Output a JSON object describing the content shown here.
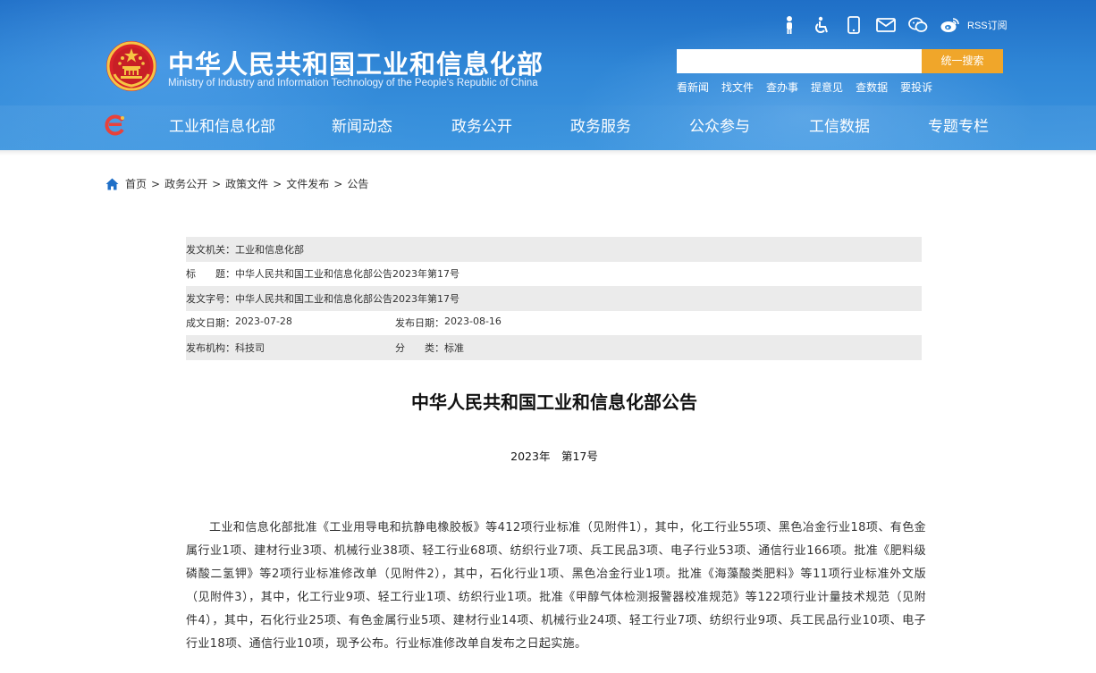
{
  "header": {
    "site_title": "中华人民共和国工业和信息化部",
    "site_subtitle": "Ministry of Industry and Information Technology of the People's Republic of China",
    "top_icons": [
      "elderly-mode-icon",
      "accessibility-icon",
      "mobile-icon",
      "mail-icon",
      "wechat-icon",
      "weibo-icon"
    ],
    "rss_label": "RSS订阅",
    "search": {
      "placeholder": "",
      "button_label": "统一搜索"
    },
    "quick_links": [
      "看新闻",
      "找文件",
      "查办事",
      "提意见",
      "查数据",
      "要投诉"
    ],
    "nav": [
      "工业和信息化部",
      "新闻动态",
      "政务公开",
      "政务服务",
      "公众参与",
      "工信数据",
      "专题专栏"
    ]
  },
  "breadcrumb": [
    "首页",
    "政务公开",
    "政策文件",
    "文件发布",
    "公告"
  ],
  "meta": {
    "issuer_label": "发文机关：",
    "issuer": "工业和信息化部",
    "title_label": "标　　题：",
    "title": "中华人民共和国工业和信息化部公告2023年第17号",
    "doc_no_label": "发文字号：",
    "doc_no": "中华人民共和国工业和信息化部公告2023年第17号",
    "written_date_label": "成文日期：",
    "written_date": "2023-07-28",
    "publish_date_label": "发布日期：",
    "publish_date": "2023-08-16",
    "org_label": "发布机构：",
    "org": "科技司",
    "category_label": "分　　类：",
    "category": "标准"
  },
  "article": {
    "title": "中华人民共和国工业和信息化部公告",
    "number": "2023年　第17号",
    "body": "工业和信息化部批准《工业用导电和抗静电橡胶板》等412项行业标准（见附件1），其中，化工行业55项、黑色冶金行业18项、有色金属行业1项、建材行业3项、机械行业38项、轻工行业68项、纺织行业7项、兵工民品3项、电子行业53项、通信行业166项。批准《肥料级磷酸二氢钾》等2项行业标准修改单（见附件2），其中，石化行业1项、黑色冶金行业1项。批准《海藻酸类肥料》等11项行业标准外文版（见附件3），其中，化工行业9项、轻工行业1项、纺织行业1项。批准《甲醇气体检测报警器校准规范》等122项行业计量技术规范（见附件4），其中，石化行业25项、有色金属行业5项、建材行业14项、机械行业24项、轻工行业7项、纺织行业9项、兵工民品行业10项、电子行业18项、通信行业10项，现予公布。行业标准修改单自发布之日起实施。"
  },
  "colors": {
    "header_blue": "#2f86d6",
    "search_button": "#f0a62a",
    "meta_row_shade": "#ebebeb"
  }
}
